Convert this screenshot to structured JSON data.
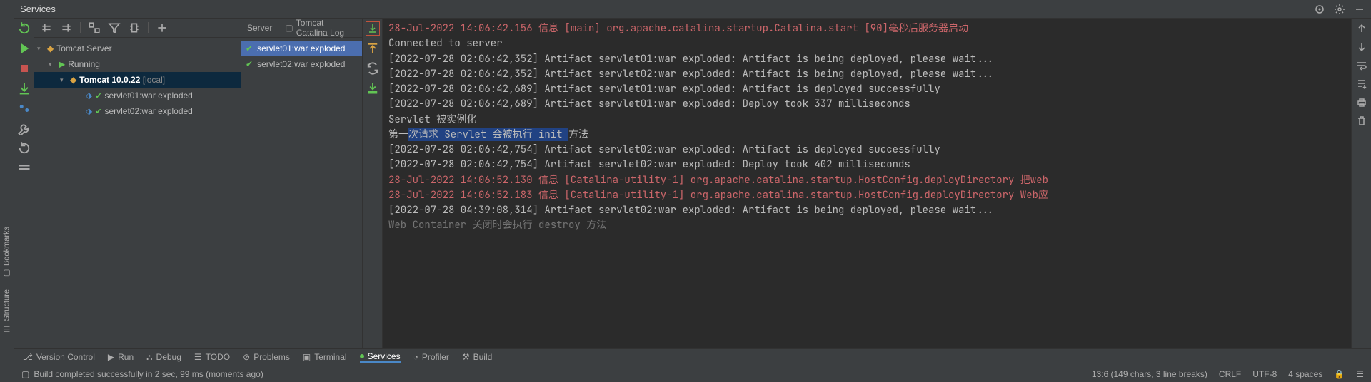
{
  "title": "Services",
  "vtabs": {
    "bookmarks": "Bookmarks",
    "structure": "Structure"
  },
  "tree_toolbar": {},
  "tree": {
    "root": "Tomcat Server",
    "running": "Running",
    "config": "Tomcat 10.0.22",
    "config_suffix": " [local]",
    "artifact1": "servlet01:war exploded",
    "artifact2": "servlet02:war exploded"
  },
  "mid_tabs": {
    "server": "Server",
    "log": "Tomcat Catalina Log"
  },
  "artifacts": {
    "a1": "servlet01:war exploded",
    "a2": "servlet02:war exploded"
  },
  "console": {
    "l1a": "28-Jul-2022 14:06:42.156 信息 [main] org.apache.catalina.startup.Catalina.start [90]毫秒后服务器启动",
    "l2": "Connected to server",
    "l3": "[2022-07-28 02:06:42,352] Artifact servlet01:war exploded: Artifact is being deployed, please wait...",
    "l4": "[2022-07-28 02:06:42,352] Artifact servlet02:war exploded: Artifact is being deployed, please wait...",
    "l5": "[2022-07-28 02:06:42,689] Artifact servlet01:war exploded: Artifact is deployed successfully",
    "l6": "[2022-07-28 02:06:42,689] Artifact servlet01:war exploded: Deploy took 337 milliseconds",
    "l7": "Servlet 被实例化",
    "l8a": "第一",
    "l8b": "次请求 Servlet 会被执行 init ",
    "l8c": "方法",
    "l9": "[2022-07-28 02:06:42,754] Artifact servlet02:war exploded: Artifact is deployed successfully",
    "l10": "[2022-07-28 02:06:42,754] Artifact servlet02:war exploded: Deploy took 402 milliseconds",
    "l11": "28-Jul-2022 14:06:52.130 信息 [Catalina-utility-1] org.apache.catalina.startup.HostConfig.deployDirectory 把web",
    "l12": "28-Jul-2022 14:06:52.183 信息 [Catalina-utility-1] org.apache.catalina.startup.HostConfig.deployDirectory Web应",
    "l13": "[2022-07-28 04:39:08,314] Artifact servlet02:war exploded: Artifact is being deployed, please wait...",
    "l14a": "Web Container 关闭时会执行 destroy 方法"
  },
  "bottom": {
    "vc": "Version Control",
    "run": "Run",
    "debug": "Debug",
    "todo": "TODO",
    "problems": "Problems",
    "terminal": "Terminal",
    "services": "Services",
    "profiler": "Profiler",
    "build": "Build"
  },
  "status": {
    "msg": "Build completed successfully in 2 sec, 99 ms (moments ago)",
    "pos": "13:6 (149 chars, 3 line breaks)",
    "eol": "CRLF",
    "enc": "UTF-8",
    "indent": "4 spaces"
  }
}
